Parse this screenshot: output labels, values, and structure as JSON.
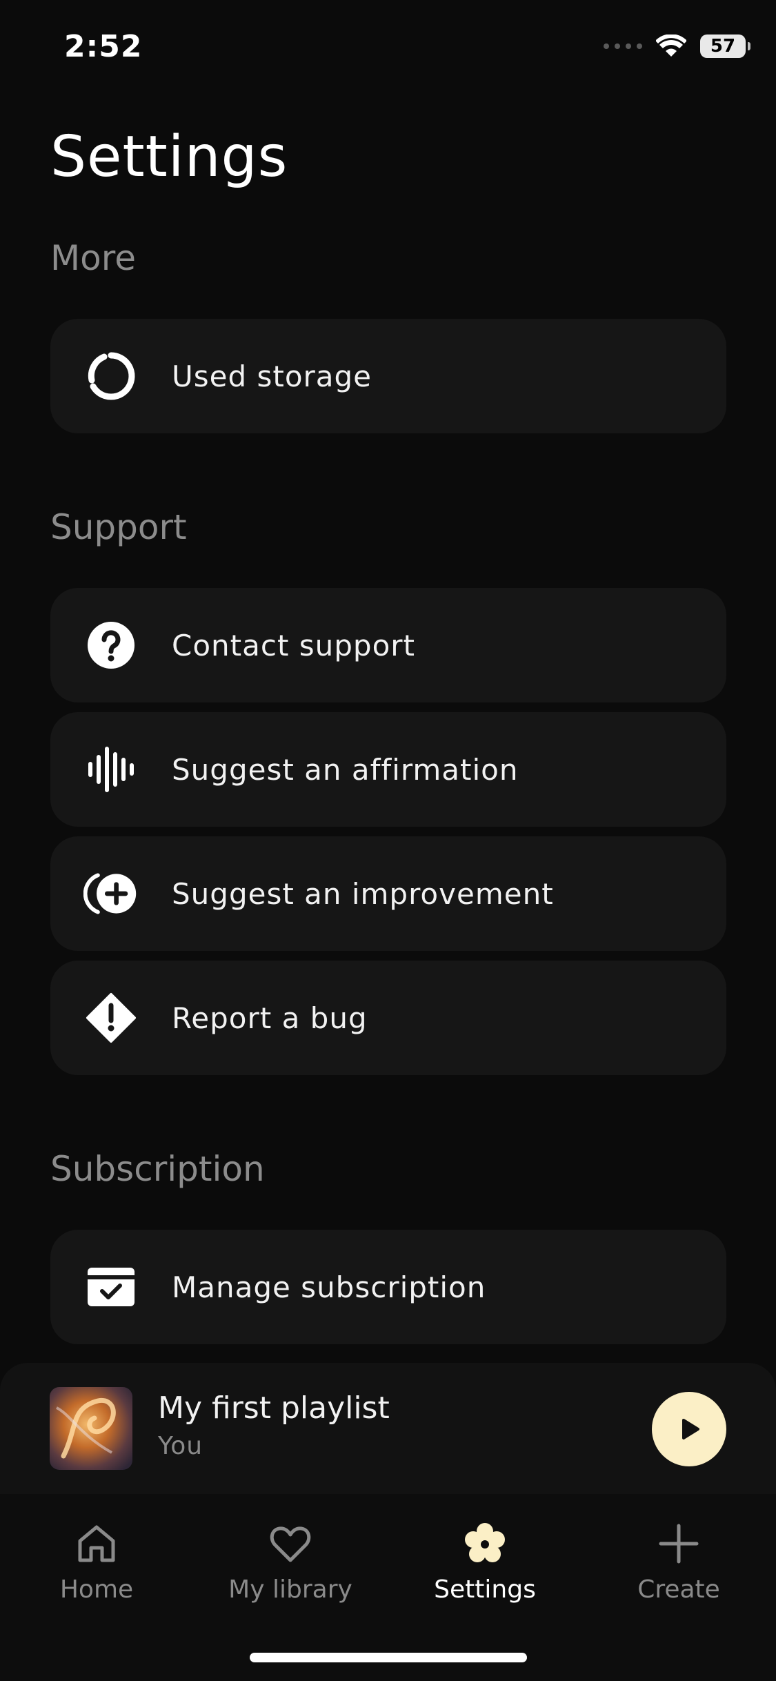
{
  "status_bar": {
    "time": "2:52",
    "battery": "57"
  },
  "page_title": "Settings",
  "sections": {
    "more": {
      "title": "More",
      "items": [
        {
          "label": "Used storage",
          "icon": "storage-ring-icon"
        }
      ]
    },
    "support": {
      "title": "Support",
      "items": [
        {
          "label": "Contact support",
          "icon": "question-circle-icon"
        },
        {
          "label": "Suggest an affirmation",
          "icon": "audio-wave-icon"
        },
        {
          "label": "Suggest an improvement",
          "icon": "add-circle-icon"
        },
        {
          "label": "Report a bug",
          "icon": "warning-diamond-icon"
        }
      ]
    },
    "subscription": {
      "title": "Subscription",
      "items": [
        {
          "label": "Manage subscription",
          "icon": "card-check-icon"
        }
      ]
    }
  },
  "mini_player": {
    "title": "My first playlist",
    "subtitle": "You"
  },
  "tabs": [
    {
      "label": "Home",
      "icon": "home-icon",
      "active": false
    },
    {
      "label": "My library",
      "icon": "heart-icon",
      "active": false
    },
    {
      "label": "Settings",
      "icon": "flower-gear-icon",
      "active": true
    },
    {
      "label": "Create",
      "icon": "plus-icon",
      "active": false
    }
  ],
  "colors": {
    "background": "#0b0b0b",
    "row_background": "#161616",
    "section_text": "#8c8c8c",
    "play_button": "#fbefc6",
    "active_tab_icon": "#fbefc6"
  }
}
